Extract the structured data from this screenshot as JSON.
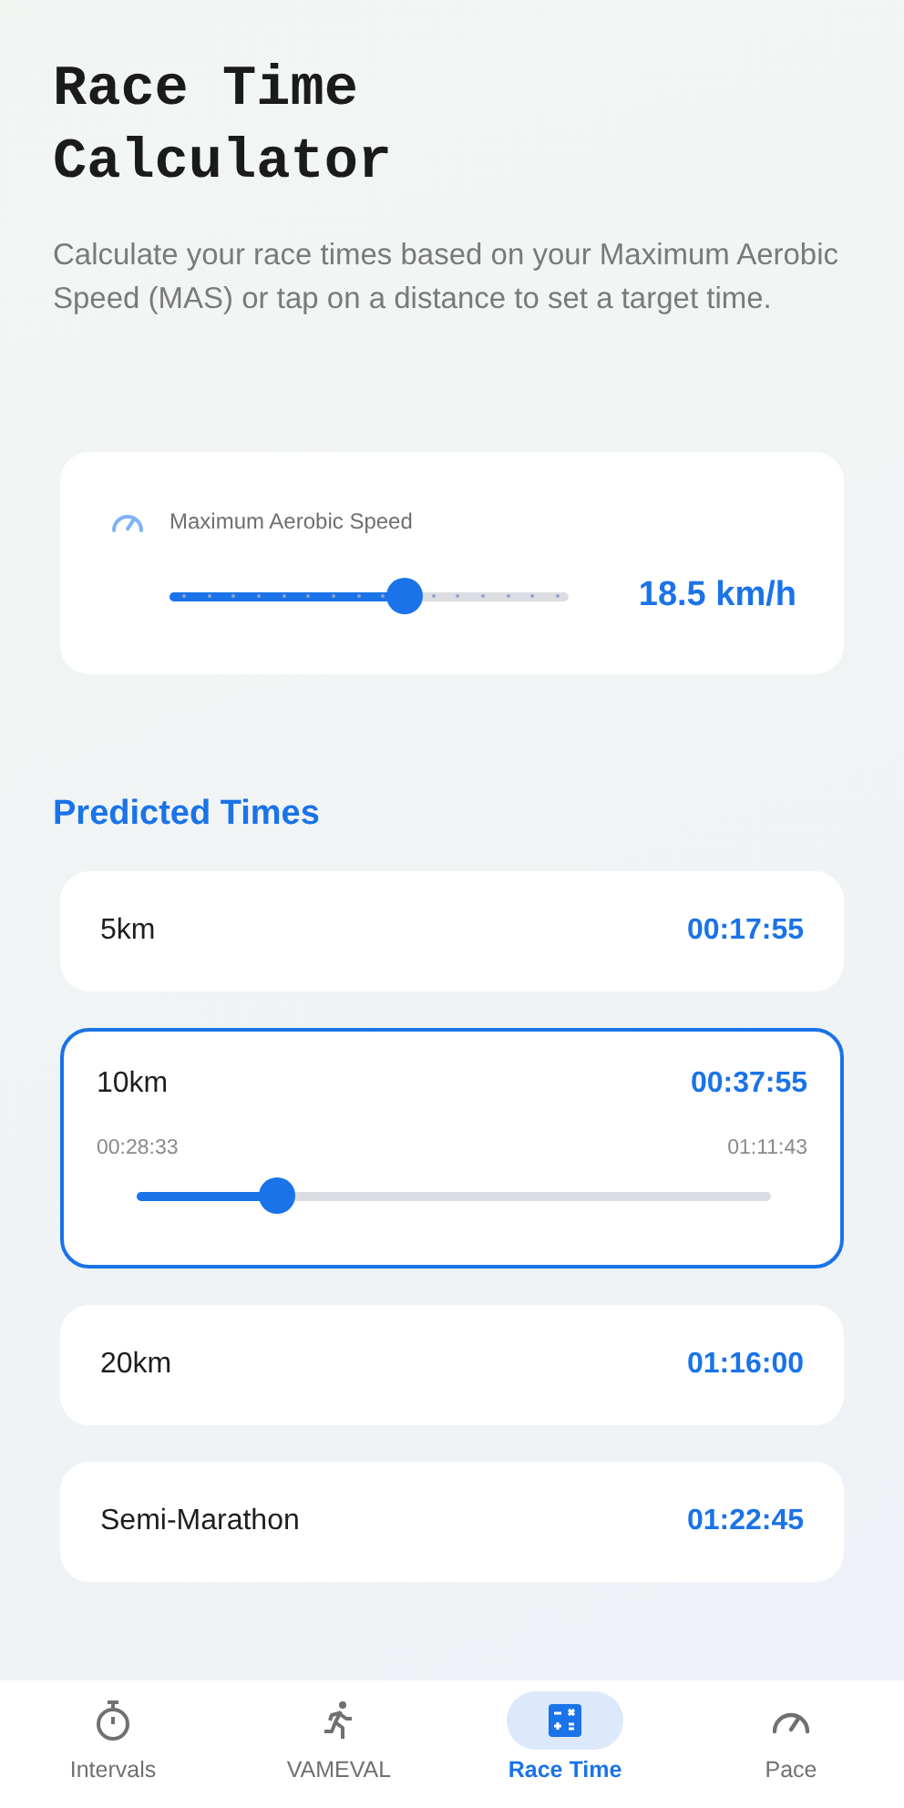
{
  "header": {
    "title": "Race Time Calculator",
    "description": "Calculate your race times based on your Maximum Aerobic Speed (MAS) or tap on a distance to set a target time."
  },
  "mas": {
    "label": "Maximum Aerobic Speed",
    "level": 0.59,
    "reading": "18.5 km/h"
  },
  "predicted": {
    "title": "Predicted Times",
    "rows": [
      {
        "distance": "5km",
        "time": "00:17:55",
        "selected": false
      },
      {
        "distance": "10km",
        "time": "00:37:55",
        "selected": true,
        "min": "00:28:33",
        "max": "01:11:43",
        "level": 0.22
      },
      {
        "distance": "20km",
        "time": "01:16:00",
        "selected": false
      },
      {
        "distance": "Semi-Marathon",
        "time": "01:22:45",
        "selected": false
      }
    ]
  },
  "nav": [
    {
      "label": "Intervals",
      "selected": false
    },
    {
      "label": "VAMEVAL",
      "selected": false
    },
    {
      "label": "Race Time",
      "selected": true
    },
    {
      "label": "Pace",
      "selected": false
    }
  ]
}
